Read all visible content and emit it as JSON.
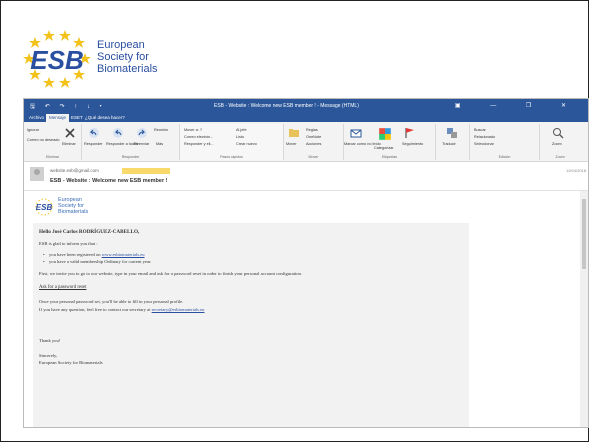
{
  "logo": {
    "line1": "European",
    "line2": "Society for",
    "line3": "Biomaterials"
  },
  "window": {
    "quick_access": "🖫 ↶ ↷ ↑ ↓ ▾",
    "title": "ESB - Website : Welcome new ESB member ! - Message (HTML)",
    "controls": "▣ — ❐ ✕"
  },
  "tabs": [
    "Archivo",
    "Mensaje",
    "ESET",
    "¿Qué desea hacer?"
  ],
  "ribbon": {
    "ignore": "Ignorar",
    "junk": "Correo no deseado",
    "delete": "Eliminar",
    "reply": "Responder",
    "reply_all": "Responder a todos",
    "forward": "Reenviar",
    "more": "Más",
    "meeting": "Reunión",
    "move_to": "Mover a: ?",
    "team_email": "Correo electrón...",
    "reply_delete": "Responder y eli...",
    "to_manager": "Al jefe",
    "done": "Listo",
    "create_new": "Crear nuevo",
    "move": "Mover",
    "rules": "Reglas",
    "onenote": "OneNote",
    "actions": "Acciones",
    "mark_unread": "Marcar como no leído",
    "categorize": "Categorizar",
    "followup": "Seguimiento",
    "translate": "Traducir",
    "find": "Buscar",
    "related": "Relacionado",
    "select": "Seleccionar",
    "zoom": "Zoom",
    "groups": [
      "Eliminar",
      "Responder",
      "Pasos rápidos",
      "Mover",
      "Etiquetas",
      "Edición",
      "Zoom"
    ]
  },
  "message": {
    "from": "website.esb@gmail.com",
    "subject": "ESB - Website : Welcome new ESB member !",
    "date": "12/04/2018"
  },
  "email_logo": {
    "line1": "European",
    "line2": "Society for",
    "line3": "Biomaterials"
  },
  "body": {
    "greeting": "Hello José Carlos RODRÍGUEZ-CABELLO,",
    "intro": "ESB is glad to inform you that :",
    "bullet1_pre": "you have been registered on ",
    "bullet1_link": "www.esbiomaterials.eu",
    "bullet2": "you have a valid membership Ordinary for current year.",
    "invite": "First, we invite you to go to our website, type in your email and ask for a password reset in order to finish your personal account configuration.",
    "reset_link": "Ask for a password reset",
    "once": "Once your personal password set, you'll be able to fill in your personal profile.",
    "questions_pre": "If you have any question, feel free to contact our secretary at ",
    "secretary_link": "secretary@esbiomaterials.eu",
    "thanks": "Thank you!",
    "sincerely": "Sincerely,",
    "signature": "European Society for Biomaterials"
  }
}
